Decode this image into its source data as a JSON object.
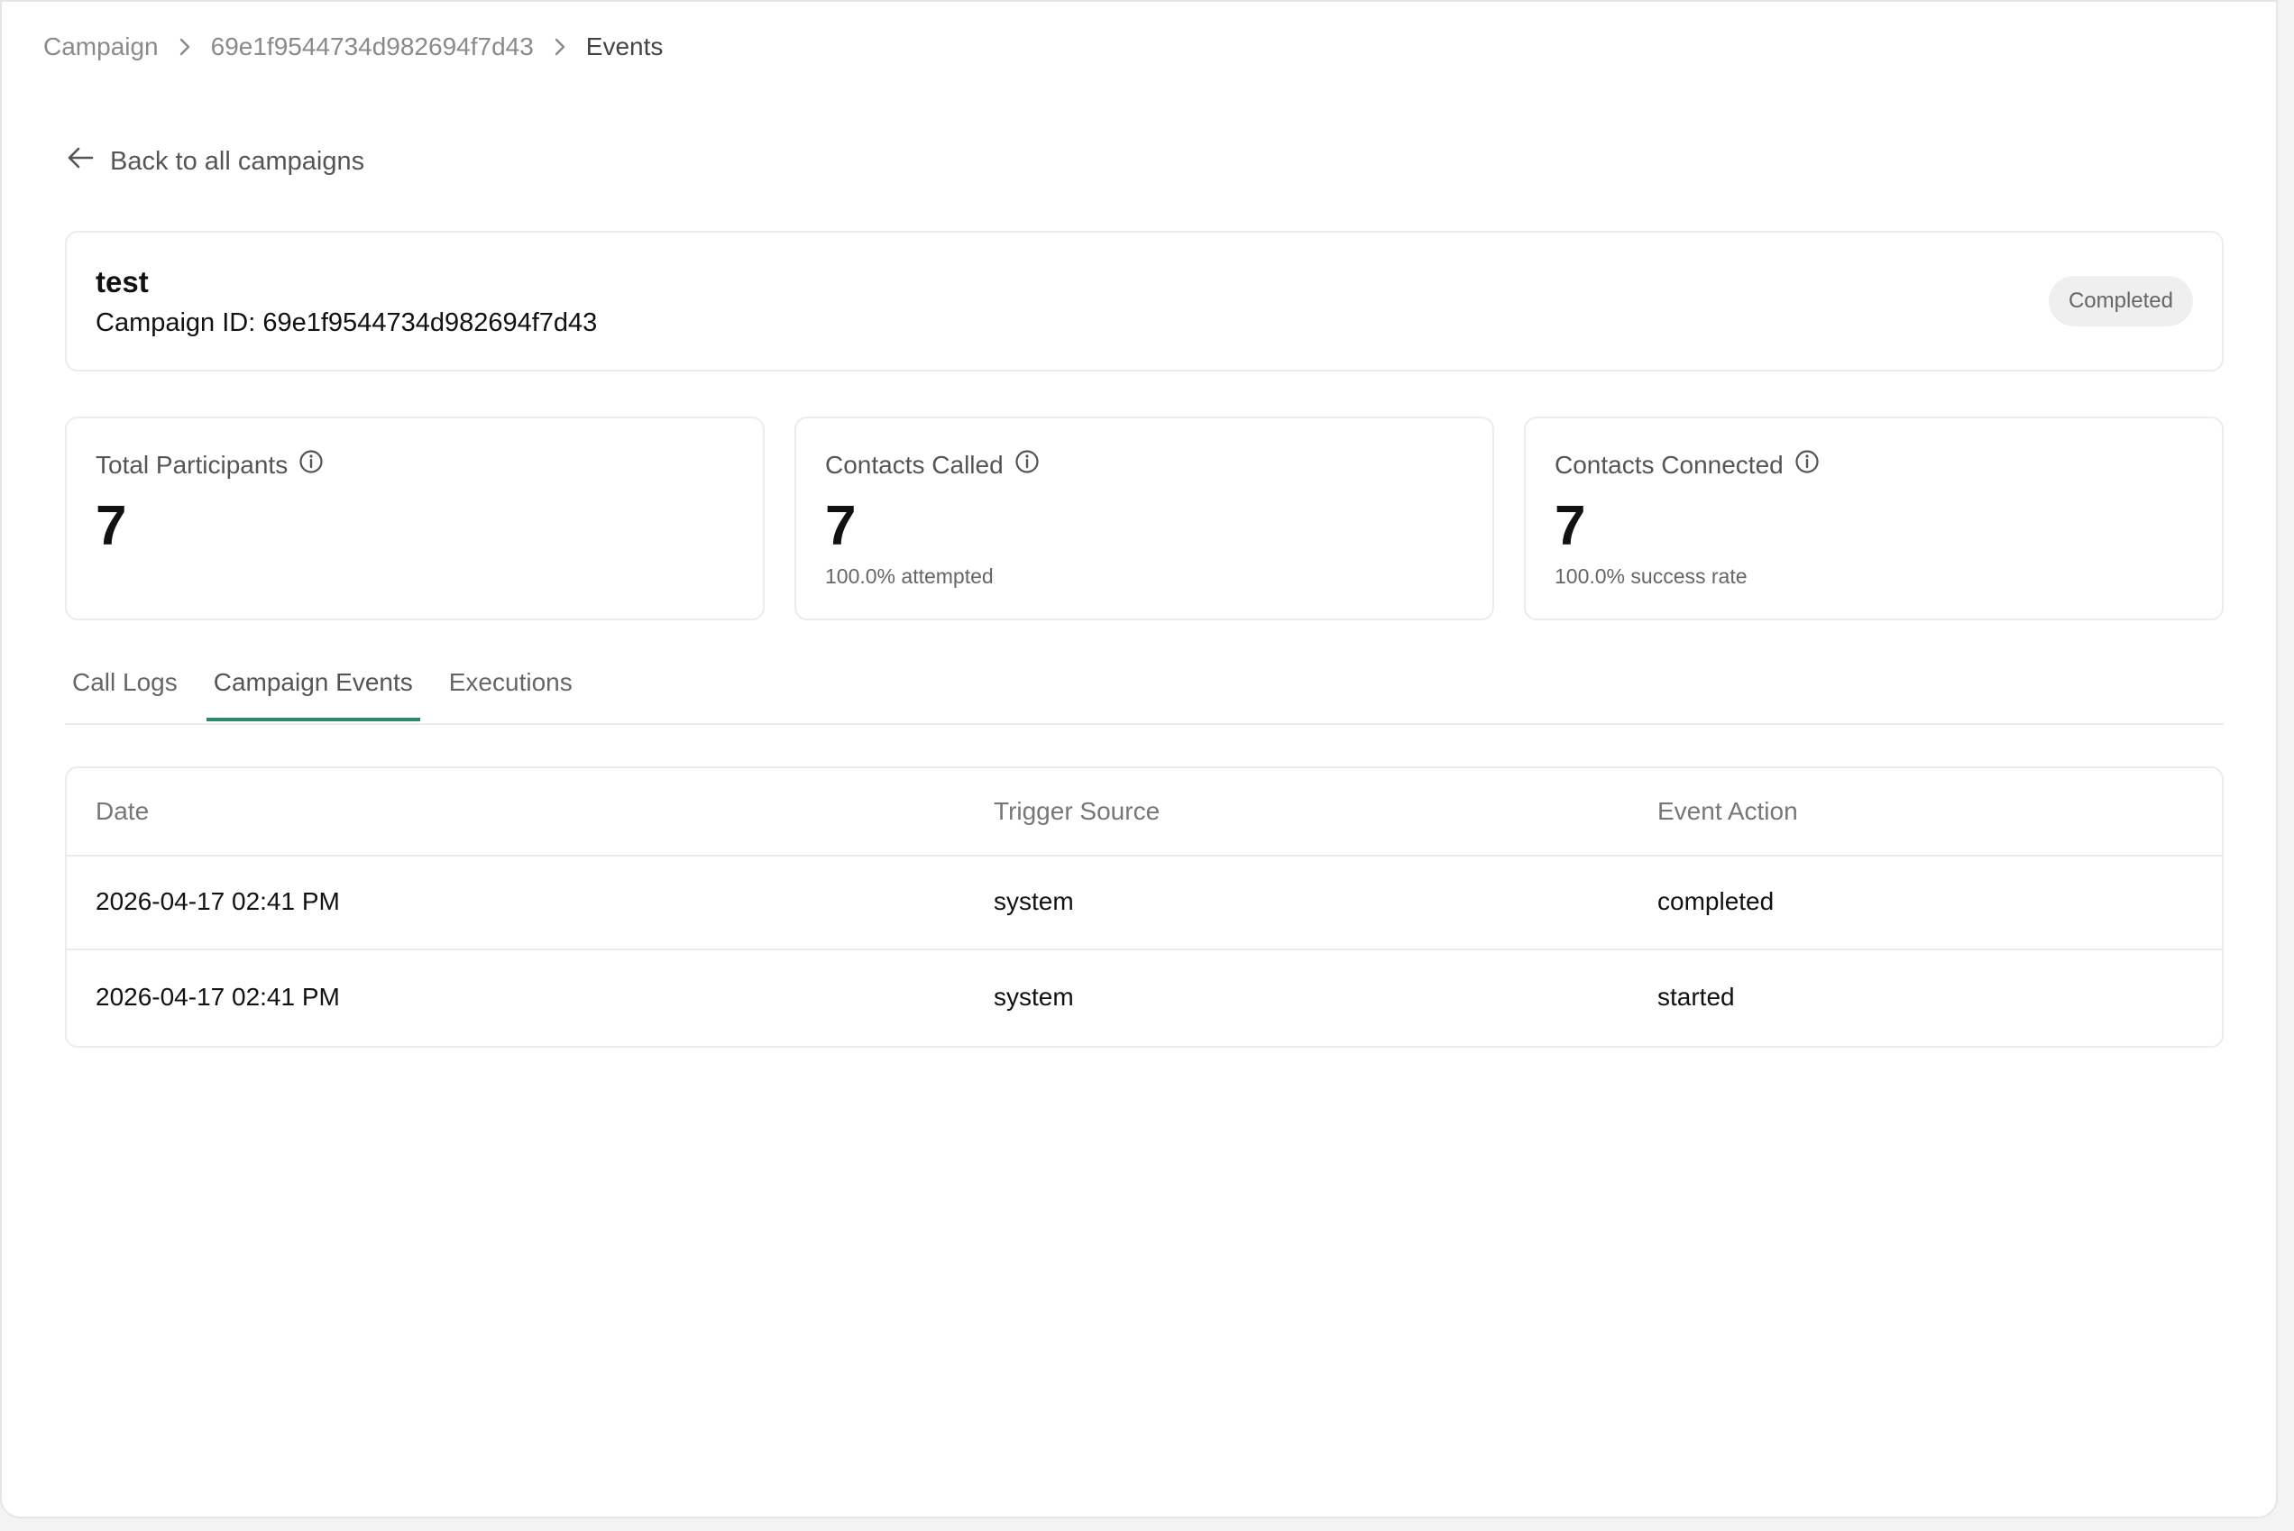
{
  "breadcrumb": {
    "items": [
      "Campaign",
      "69e1f9544734d982694f7d43",
      "Events"
    ]
  },
  "back_link": {
    "label": "Back to all campaigns"
  },
  "campaign": {
    "name": "test",
    "id_text": "Campaign ID: 69e1f9544734d982694f7d43",
    "status": "Completed"
  },
  "stats": [
    {
      "label": "Total Participants",
      "value": "7",
      "sub": ""
    },
    {
      "label": "Contacts Called",
      "value": "7",
      "sub": "100.0% attempted"
    },
    {
      "label": "Contacts Connected",
      "value": "7",
      "sub": "100.0% success rate"
    }
  ],
  "tabs": [
    {
      "label": "Call Logs",
      "active": false
    },
    {
      "label": "Campaign Events",
      "active": true
    },
    {
      "label": "Executions",
      "active": false
    }
  ],
  "table": {
    "columns": [
      "Date",
      "Trigger Source",
      "Event Action"
    ],
    "rows": [
      [
        "2026-04-17 02:41 PM",
        "system",
        "completed"
      ],
      [
        "2026-04-17 02:41 PM",
        "system",
        "started"
      ]
    ]
  },
  "colors": {
    "accent": "#2a8a6e",
    "badge_bg": "#efefef",
    "border": "#ececec"
  }
}
